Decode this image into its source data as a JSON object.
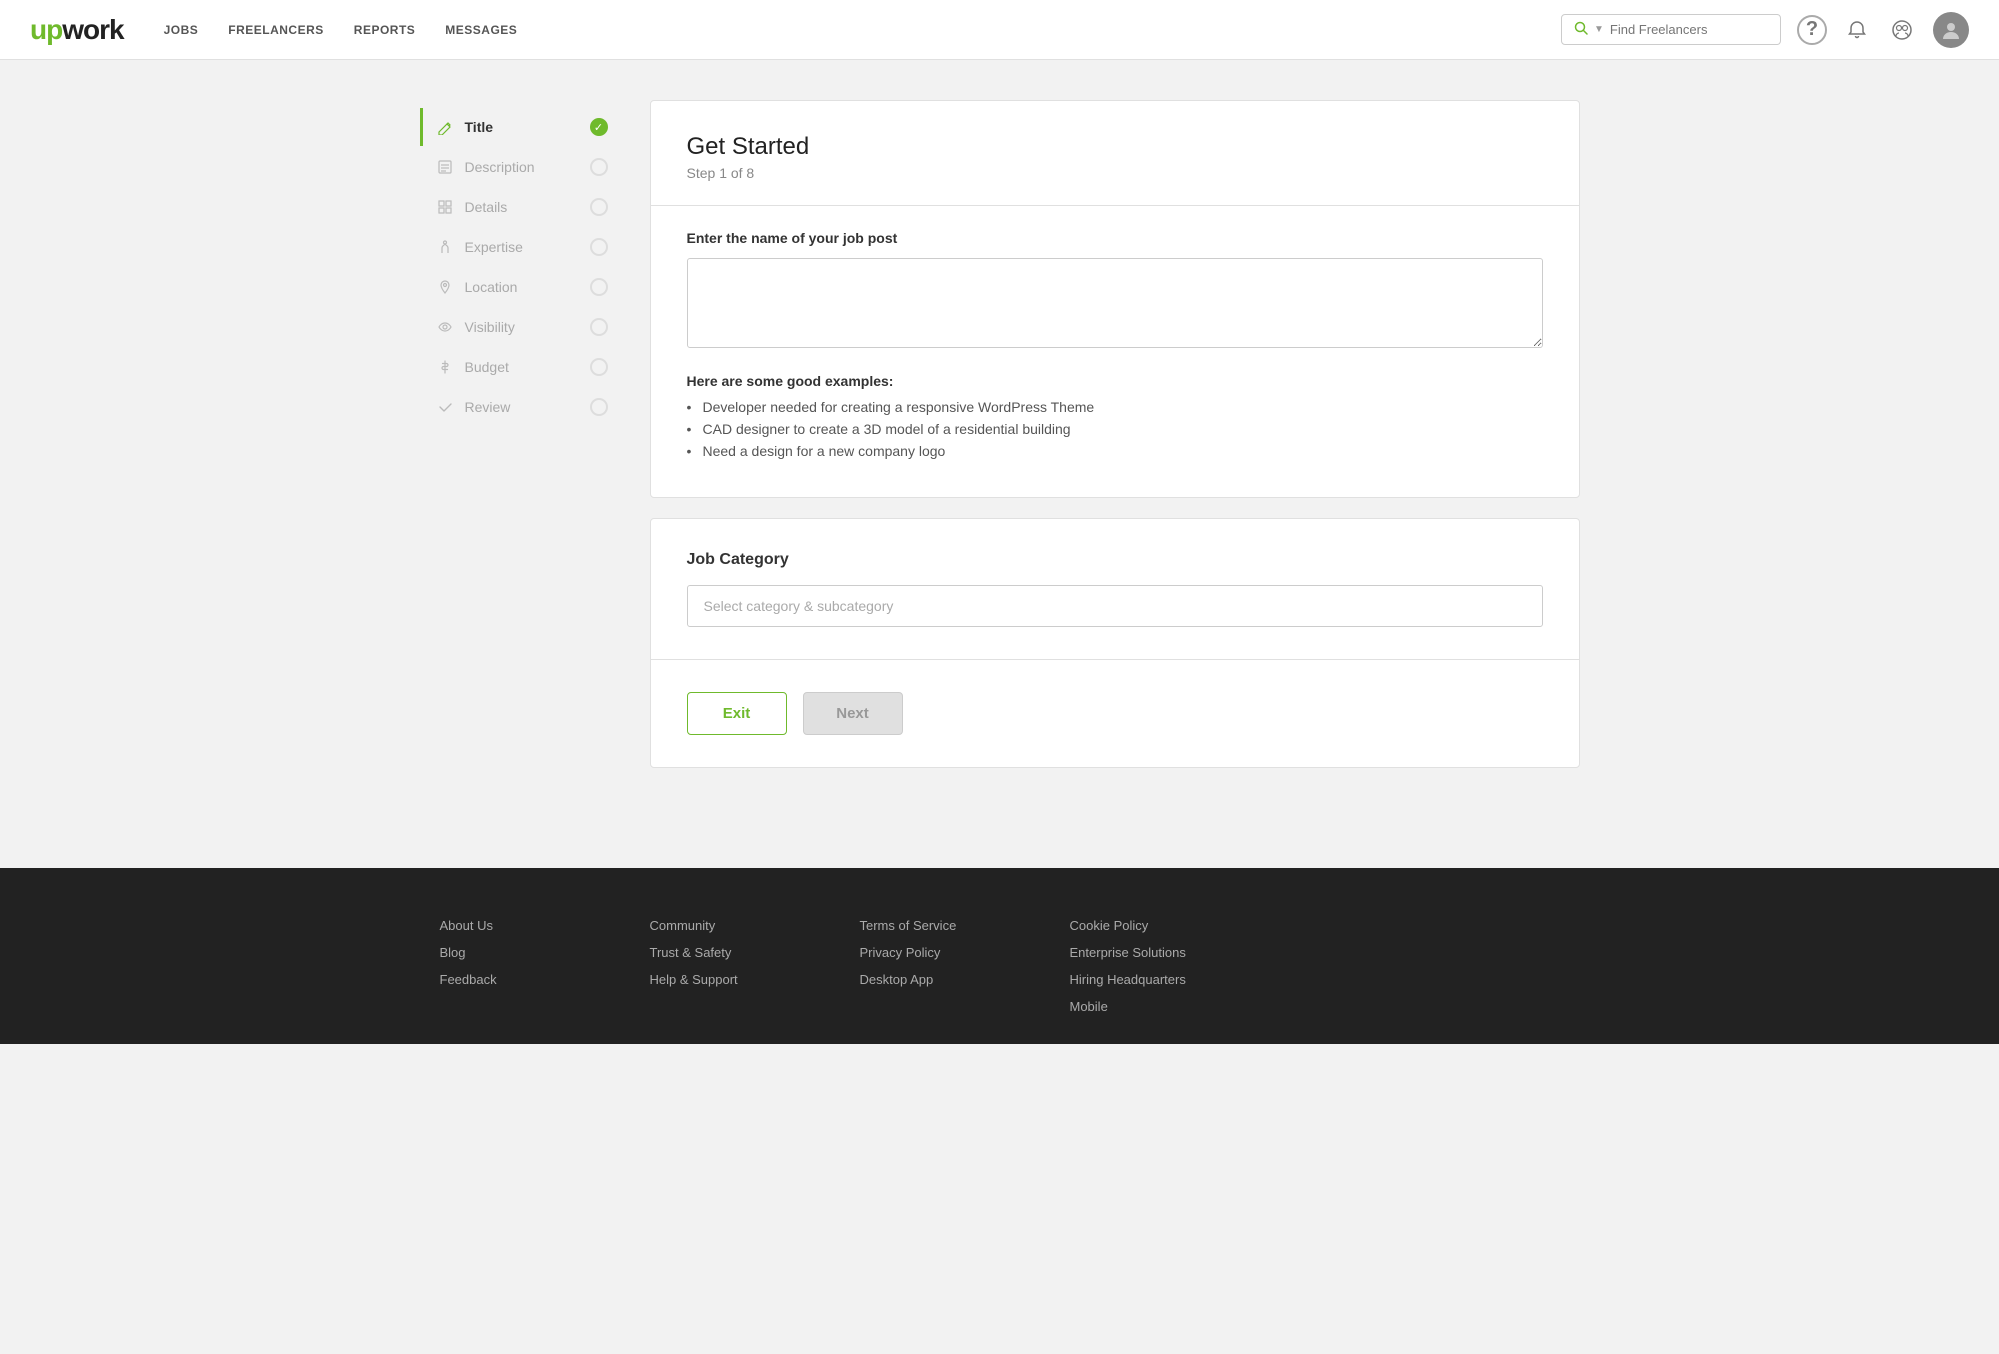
{
  "header": {
    "logo_up": "up",
    "logo_work": "work",
    "nav": [
      "Jobs",
      "Freelancers",
      "Reports",
      "Messages"
    ],
    "search_placeholder": "Find Freelancers",
    "help_tooltip": "?",
    "notifications_icon": "🔔",
    "switch_icon": "⇄"
  },
  "sidebar": {
    "items": [
      {
        "id": "title",
        "label": "Title",
        "icon": "✏️",
        "active": true,
        "checked": true
      },
      {
        "id": "description",
        "label": "Description",
        "icon": "📄",
        "active": false,
        "checked": false
      },
      {
        "id": "details",
        "label": "Details",
        "icon": "☰",
        "active": false,
        "checked": false
      },
      {
        "id": "expertise",
        "label": "Expertise",
        "icon": "✋",
        "active": false,
        "checked": false
      },
      {
        "id": "location",
        "label": "Location",
        "icon": "📍",
        "active": false,
        "checked": false
      },
      {
        "id": "visibility",
        "label": "Visibility",
        "icon": "🔍",
        "active": false,
        "checked": false
      },
      {
        "id": "budget",
        "label": "Budget",
        "icon": "💲",
        "active": false,
        "checked": false
      },
      {
        "id": "review",
        "label": "Review",
        "icon": "✔",
        "active": false,
        "checked": false
      }
    ]
  },
  "main": {
    "card1": {
      "title": "Get Started",
      "subtitle": "Step 1 of 8",
      "field_label": "Enter the name of your job post",
      "textarea_value": "",
      "examples_heading": "Here are some good examples:",
      "examples": [
        "Developer needed for creating a responsive WordPress Theme",
        "CAD designer to create a 3D model of a residential building",
        "Need a design for a new company logo"
      ]
    },
    "card2": {
      "category_label": "Job Category",
      "category_placeholder": "Select category & subcategory"
    },
    "buttons": {
      "exit_label": "Exit",
      "next_label": "Next"
    }
  },
  "footer": {
    "cols": [
      {
        "links": [
          "About Us",
          "Blog",
          "Feedback"
        ]
      },
      {
        "links": [
          "Community",
          "Trust & Safety",
          "Help & Support"
        ]
      },
      {
        "links": [
          "Terms of Service",
          "Privacy Policy",
          "Desktop App"
        ]
      },
      {
        "links": [
          "Cookie Policy",
          "Enterprise Solutions",
          "Hiring Headquarters",
          "Mobile"
        ]
      }
    ]
  }
}
